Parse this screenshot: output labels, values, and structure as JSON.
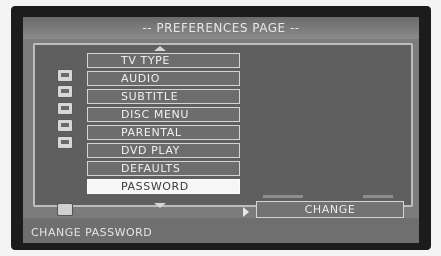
{
  "title": "-- PREFERENCES PAGE --",
  "menu": {
    "items": [
      {
        "label": "TV TYPE"
      },
      {
        "label": "AUDIO"
      },
      {
        "label": "SUBTITLE"
      },
      {
        "label": "DISC MENU"
      },
      {
        "label": "PARENTAL"
      },
      {
        "label": "DVD PLAY"
      },
      {
        "label": "DEFAULTS"
      },
      {
        "label": "PASSWORD"
      }
    ],
    "selected_index": 7
  },
  "option": {
    "label": "CHANGE"
  },
  "status": "CHANGE PASSWORD"
}
